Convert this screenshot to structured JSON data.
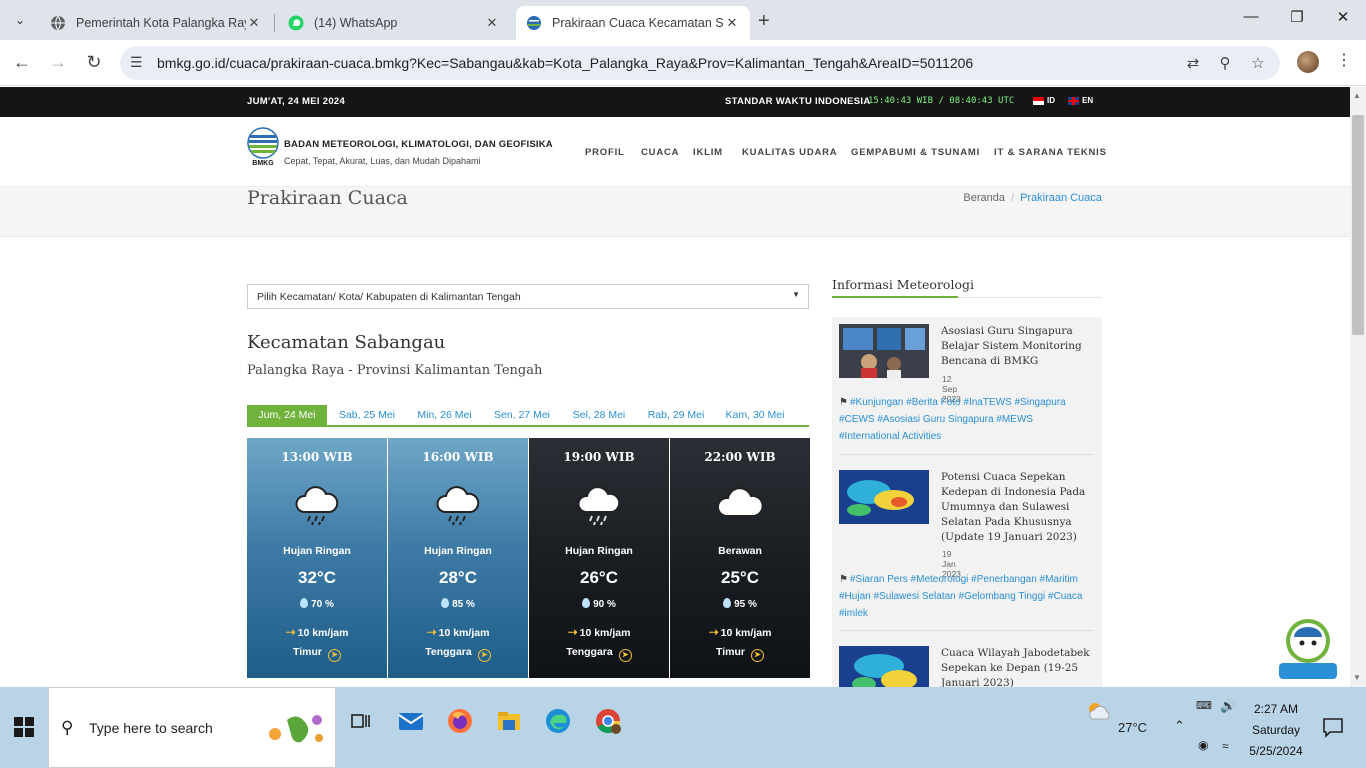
{
  "browser": {
    "tabs": [
      {
        "title": "Pemerintah Kota Palangka Raya",
        "icon": "globe-icon"
      },
      {
        "title": "(14) WhatsApp",
        "icon": "whatsapp-icon"
      },
      {
        "title": "Prakiraan Cuaca Kecamatan Sabangau",
        "icon": "bmkg-icon"
      }
    ],
    "url": "bmkg.go.id/cuaca/prakiraan-cuaca.bmkg?Kec=Sabangau&kab=Kota_Palangka_Raya&Prov=Kalimantan_Tengah&AreaID=5011206"
  },
  "site": {
    "topbar": {
      "date": "JUM'AT, 24 MEI 2024",
      "standard_time_label": "STANDAR WAKTU INDONESIA",
      "clock": "15:40:43 WIB / 08:40:43 UTC",
      "lang_id": "ID",
      "lang_en": "EN"
    },
    "org_name": "BADAN METEOROLOGI, KLIMATOLOGI, DAN GEOFISIKA",
    "org_tagline": "Cepat, Tepat, Akurat, Luas, dan Mudah Dipahami",
    "logo_text": "BMKG",
    "nav": [
      "PROFIL",
      "CUACA",
      "IKLIM",
      "KUALITAS UDARA",
      "GEMPABUMI & TSUNAMI",
      "IT & SARANA TEKNIS"
    ],
    "page_title": "Prakiraan Cuaca",
    "breadcrumb": {
      "home": "Beranda",
      "current": "Prakiraan Cuaca"
    }
  },
  "forecast": {
    "select_placeholder": "Pilih Kecamatan/ Kota/ Kabupaten di Kalimantan Tengah",
    "district": "Kecamatan Sabangau",
    "region": "Palangka Raya - Provinsi Kalimantan Tengah",
    "days": [
      "Jum, 24 Mei",
      "Sab, 25 Mei",
      "Min, 26 Mei",
      "Sen, 27 Mei",
      "Sel, 28 Mei",
      "Rab, 29 Mei",
      "Kam, 30 Mei"
    ],
    "active_day": 0,
    "cards": [
      {
        "time": "13:00 WIB",
        "condition": "Hujan Ringan",
        "temp": "32°C",
        "humidity": "70 %",
        "wind": "10 km/jam",
        "direction": "Timur",
        "icon": "rain-cloud-icon",
        "theme": "day"
      },
      {
        "time": "16:00 WIB",
        "condition": "Hujan Ringan",
        "temp": "28°C",
        "humidity": "85 %",
        "wind": "10 km/jam",
        "direction": "Tenggara",
        "icon": "rain-cloud-icon",
        "theme": "day"
      },
      {
        "time": "19:00 WIB",
        "condition": "Hujan Ringan",
        "temp": "26°C",
        "humidity": "90 %",
        "wind": "10 km/jam",
        "direction": "Tenggara",
        "icon": "rain-cloud-icon",
        "theme": "night"
      },
      {
        "time": "22:00 WIB",
        "condition": "Berawan",
        "temp": "25°C",
        "humidity": "95 %",
        "wind": "10 km/jam",
        "direction": "Timur",
        "icon": "cloud-icon",
        "theme": "night"
      }
    ]
  },
  "sidebar": {
    "title": "Informasi Meteorologi",
    "news": [
      {
        "title": "Asosiasi Guru Singapura Belajar Sistem Monitoring Bencana di BMKG",
        "date": "12 Sep 2023",
        "tags": "#Kunjungan #Berita Foto #InaTEWS #Singapura #CEWS #Asosiasi Guru Singapura #MEWS #International Activities"
      },
      {
        "title": "Potensi Cuaca Sepekan Kedepan di Indonesia Pada Umumnya dan Sulawesi Selatan Pada Khususnya (Update 19 Januari 2023)",
        "date": "19 Jan 2023",
        "tags": "#Siaran Pers #Meteorologi #Penerbangan #Maritim #Hujan #Sulawesi Selatan #Gelombang Tinggi #Cuaca #imlek"
      },
      {
        "title": "Cuaca Wilayah Jabodetabek Sepekan ke Depan (19-25 Januari 2023)",
        "date": "",
        "tags": ""
      }
    ]
  },
  "taskbar": {
    "search_placeholder": "Type here to search",
    "weather": "27°C",
    "time": "2:27 AM",
    "day": "Saturday",
    "date": "5/25/2024"
  },
  "colors": {
    "accent_green": "#6fb33d",
    "link_blue": "#2a8fd4",
    "topbar_black": "#151515"
  }
}
